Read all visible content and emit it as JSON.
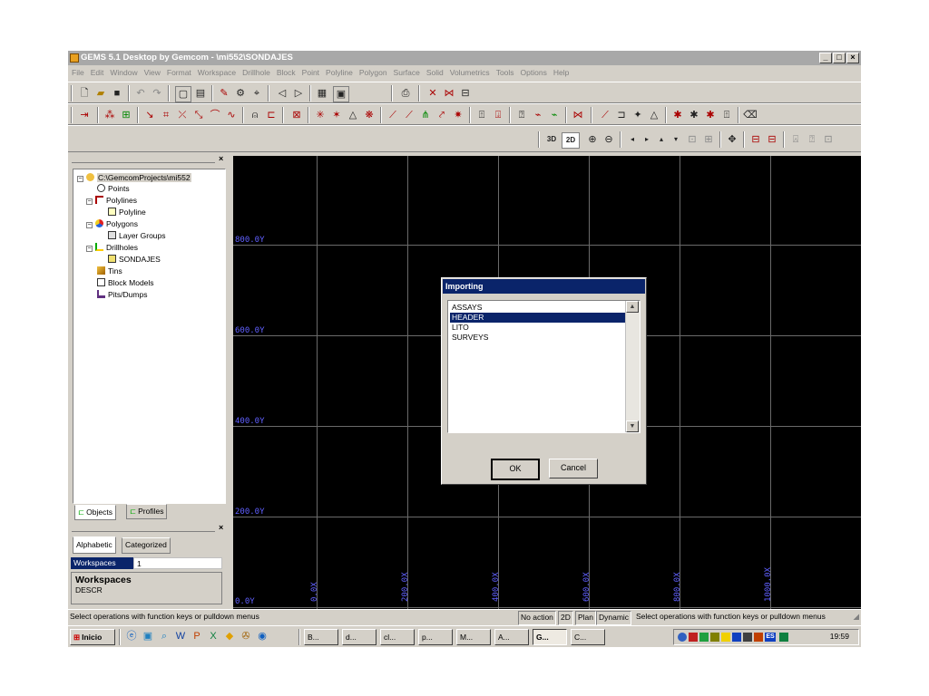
{
  "window": {
    "title": "GEMS 5.1 Desktop by Gemcom - \\mi552\\SONDAJES",
    "minimize": "_",
    "maximize": "□",
    "close": "×"
  },
  "menu": [
    "File",
    "Edit",
    "Window",
    "View",
    "Format",
    "Workspace",
    "Drillhole",
    "Block",
    "Point",
    "Polyline",
    "Polygon",
    "Surface",
    "Solid",
    "Volumetrics",
    "Tools",
    "Options",
    "Help"
  ],
  "view_toolbar": {
    "btn_3d": "3D",
    "btn_2d": "2D"
  },
  "tree": {
    "root": "C:\\GemcomProjects\\mi552",
    "items": [
      {
        "label": "Points"
      },
      {
        "label": "Polylines"
      },
      {
        "label": "Polyline"
      },
      {
        "label": "Polygons"
      },
      {
        "label": "Layer Groups"
      },
      {
        "label": "Drillholes"
      },
      {
        "label": "SONDAJES"
      },
      {
        "label": "Tins"
      },
      {
        "label": "Block Models"
      },
      {
        "label": "Pits/Dumps"
      }
    ]
  },
  "tree_tabs": [
    "Objects",
    "Profiles"
  ],
  "props": {
    "tabs": [
      "Alphabetic",
      "Categorized"
    ],
    "row_name": "Workspaces",
    "row_value": "1",
    "desc_title": "Workspaces",
    "desc_text": "DESCR"
  },
  "canvas": {
    "y_labels": [
      "800.0Y",
      "600.0Y",
      "400.0Y",
      "200.0Y",
      "0.0Y"
    ],
    "x_labels": [
      "0.0X",
      "200.0X",
      "400.0X",
      "600.0X",
      "800.0X",
      "1000.0X"
    ]
  },
  "dialog": {
    "title": "Importing",
    "items": [
      "ASSAYS",
      "HEADER",
      "LITO",
      "SURVEYS"
    ],
    "selected_index": 1,
    "ok": "OK",
    "cancel": "Cancel"
  },
  "status": {
    "left": "Select operations with function keys or pulldown menus",
    "action": "No action",
    "dim": "2D",
    "view": "Plan",
    "mode": "Dynamic",
    "right": "Select operations with function keys or pulldown menus"
  },
  "taskbar": {
    "start": "Inicio",
    "tasks": [
      "B...",
      "d...",
      "cl...",
      "p...",
      "M...",
      "A...",
      "G...",
      "C..."
    ],
    "lang": "ES",
    "clock": "19:59"
  },
  "colors": {
    "title_active": "#0a246a",
    "canvas_bg": "#000000",
    "axis_label": "#6060ff"
  }
}
